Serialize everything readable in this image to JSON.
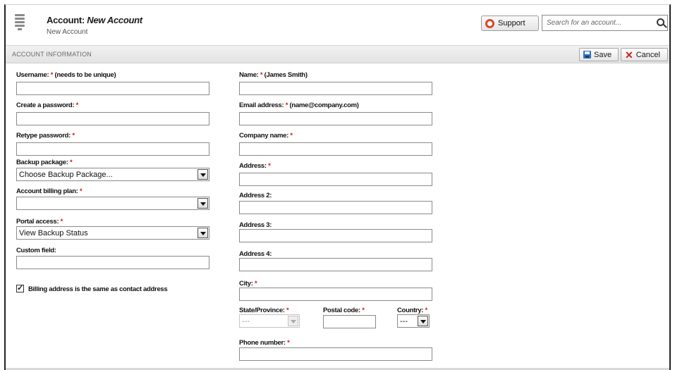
{
  "header": {
    "title_prefix": "Account:",
    "title_name": "New Account",
    "subtitle": "New Account",
    "support_label": "Support",
    "search_placeholder": "Search for an account..."
  },
  "section": {
    "title": "ACCOUNT INFORMATION",
    "save_label": "Save",
    "cancel_label": "Cancel"
  },
  "left_fields": {
    "username": {
      "label": "Username:",
      "hint": "(needs to be unique)"
    },
    "create_password": {
      "label": "Create a password:"
    },
    "retype_password": {
      "label": "Retype password:"
    },
    "backup_package": {
      "label": "Backup package:",
      "value": "Choose Backup Package..."
    },
    "billing_plan": {
      "label": "Account billing plan:",
      "value": ""
    },
    "portal_access": {
      "label": "Portal access:",
      "value": "View Backup Status"
    },
    "custom_field": {
      "label": "Custom field:"
    },
    "billing_same": {
      "label": "Billing address is the same as contact address",
      "checked": true
    }
  },
  "right_fields": {
    "name": {
      "label": "Name:",
      "hint": "(James Smith)"
    },
    "email": {
      "label": "Email address:",
      "hint": "(name@company.com)"
    },
    "company": {
      "label": "Company name:"
    },
    "address1": {
      "label": "Address:"
    },
    "address2": {
      "label": "Address 2:"
    },
    "address3": {
      "label": "Address 3:"
    },
    "address4": {
      "label": "Address 4:"
    },
    "city": {
      "label": "City:"
    },
    "state": {
      "label": "State/Province:",
      "value": "---"
    },
    "postal": {
      "label": "Postal code:"
    },
    "country": {
      "label": "Country:",
      "value": "---"
    },
    "phone": {
      "label": "Phone number:"
    }
  },
  "required_marker": "*",
  "colors": {
    "required": "#d01818",
    "save_icon": "#2f6fc2",
    "cancel_icon": "#d21d1d",
    "support_icon": "#d44a2a"
  }
}
